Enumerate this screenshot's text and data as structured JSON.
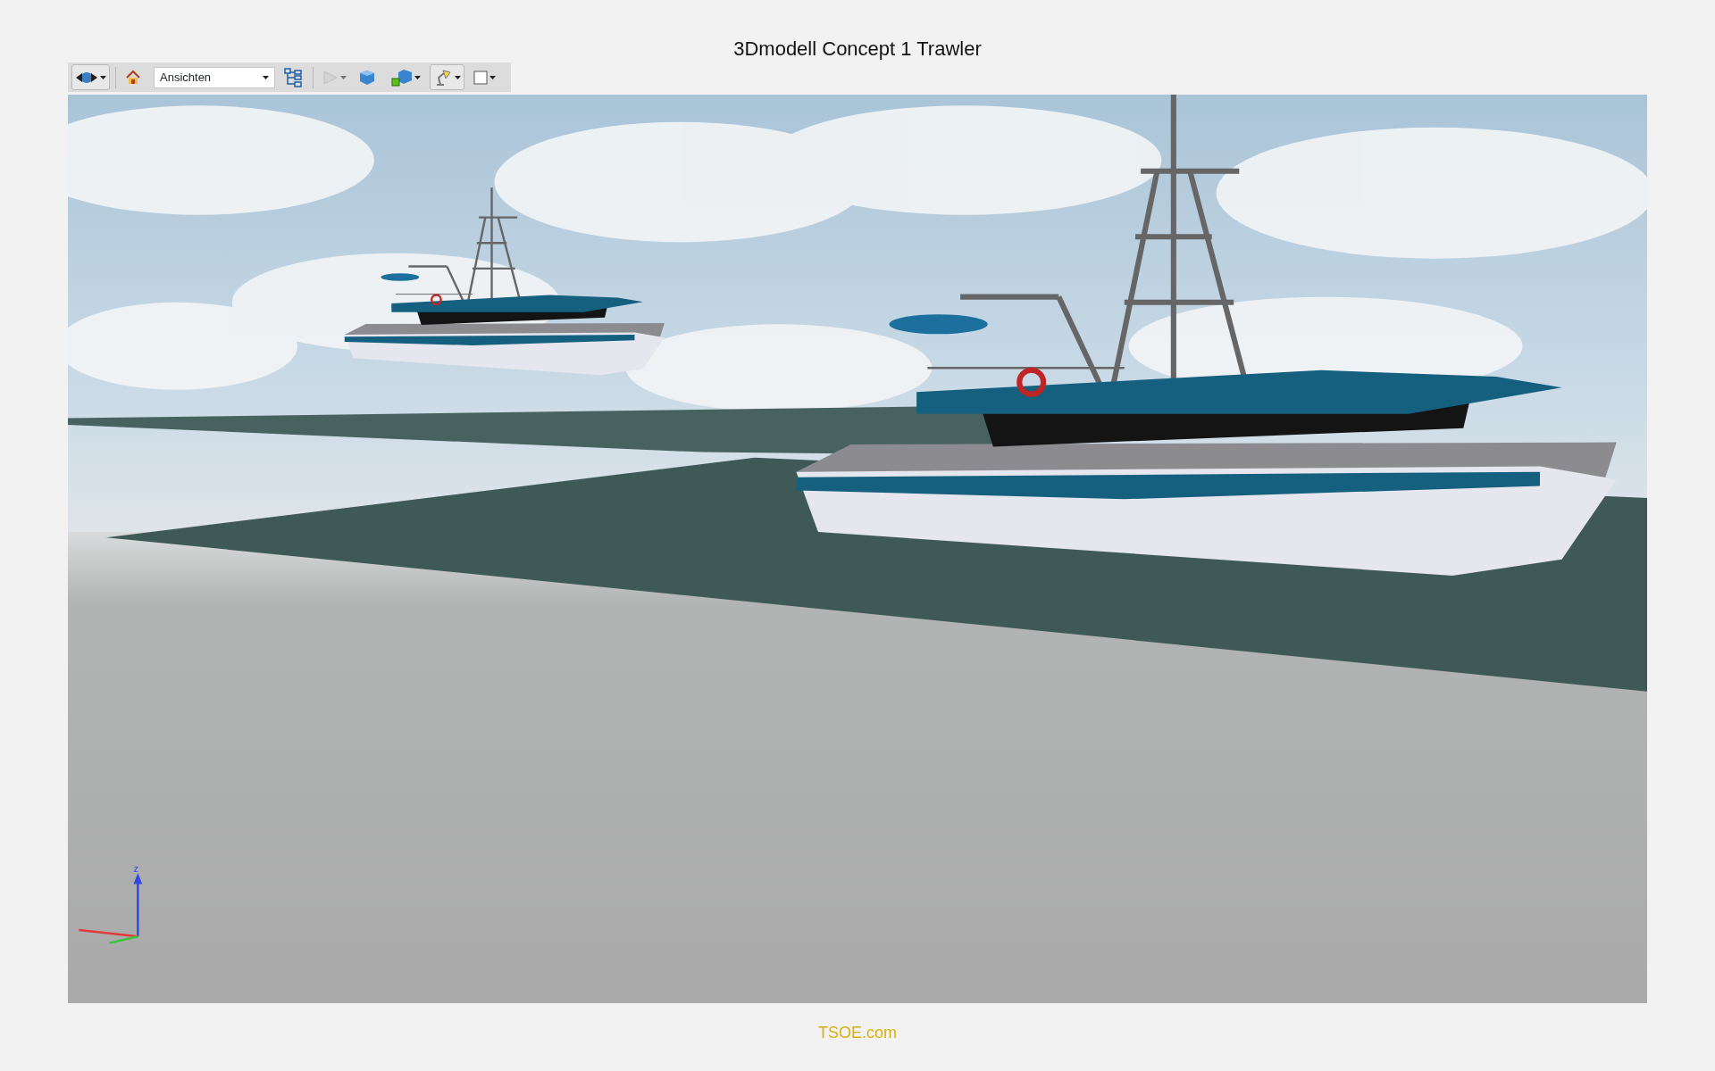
{
  "title": "3Dmodell Concept 1 Trawler",
  "toolbar": {
    "items": [
      {
        "kind": "rotate",
        "selected": true,
        "disabled": false,
        "dropdown": true
      },
      {
        "kind": "separator"
      },
      {
        "kind": "home",
        "selected": false,
        "disabled": false,
        "dropdown": false
      },
      {
        "kind": "combo",
        "value": "Ansichten"
      },
      {
        "kind": "tree",
        "selected": false,
        "disabled": false,
        "dropdown": false
      },
      {
        "kind": "separator"
      },
      {
        "kind": "play",
        "selected": false,
        "disabled": true,
        "dropdown": true
      },
      {
        "kind": "cube",
        "selected": false,
        "disabled": false,
        "dropdown": false
      },
      {
        "kind": "cubes",
        "selected": false,
        "disabled": false,
        "dropdown": true
      },
      {
        "kind": "lamp",
        "selected": true,
        "disabled": false,
        "dropdown": true
      },
      {
        "kind": "frame",
        "selected": false,
        "disabled": false,
        "dropdown": true
      }
    ]
  },
  "viewport": {
    "axis_label": "z"
  },
  "footer": "TSOE.com"
}
